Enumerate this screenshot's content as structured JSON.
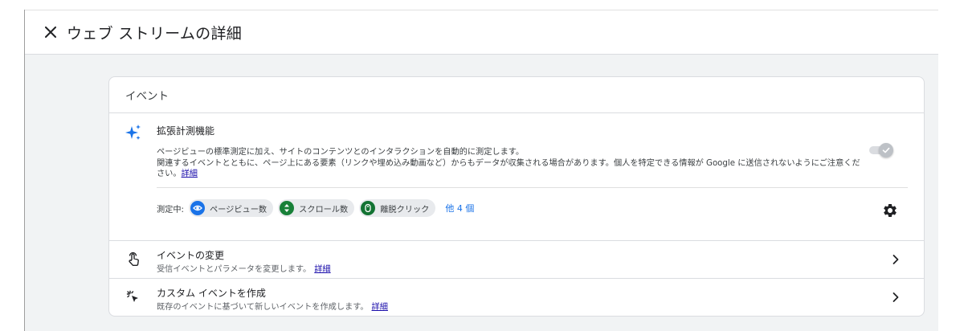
{
  "header": {
    "title": "ウェブ ストリームの詳細",
    "close_icon": "close-icon"
  },
  "events_card": {
    "title": "イベント",
    "enhanced": {
      "icon": "sparkle-icon",
      "title": "拡張計測機能",
      "desc_line1": "ページビューの標準測定に加え、サイトのコンテンツとのインタラクションを自動的に測定します。",
      "desc_line2": "関連するイベントとともに、ページ上にある要素（リンクや埋め込み動画など）からもデータが収集される場合があります。個人を特定できる情報が Google に送信されないようにご注意ください。",
      "link": "詳細",
      "toggle_on": true,
      "measuring_label": "測定中:",
      "chips": [
        {
          "icon": "eye-icon",
          "label": "ページビュー数",
          "color": "#1a73e8"
        },
        {
          "icon": "scroll-icon",
          "label": "スクロール数",
          "color": "#188038"
        },
        {
          "icon": "mouse-icon",
          "label": "離脱クリック",
          "color": "#137333"
        }
      ],
      "more": "他 4 個",
      "settings_icon": "gear-icon"
    },
    "rows": [
      {
        "icon": "touch-icon",
        "title": "イベントの変更",
        "sub": "受信イベントとパラメータを変更します。",
        "link": "詳細",
        "chevron": "chevron-right-icon"
      },
      {
        "icon": "click-icon",
        "title": "カスタム イベントを作成",
        "sub": "既存のイベントに基づいて新しいイベントを作成します。",
        "link": "詳細",
        "chevron": "chevron-right-icon"
      }
    ]
  }
}
